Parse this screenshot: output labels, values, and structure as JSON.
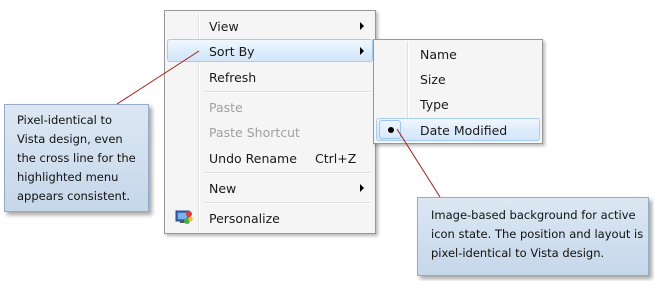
{
  "main_menu": {
    "items": [
      {
        "label": "View",
        "submenu": true
      },
      {
        "label": "Sort By",
        "submenu": true,
        "highlighted": true
      },
      {
        "label": "Refresh"
      },
      {
        "label": "Paste",
        "disabled": true
      },
      {
        "label": "Paste Shortcut",
        "disabled": true
      },
      {
        "label": "Undo Rename",
        "shortcut": "Ctrl+Z"
      },
      {
        "label": "New",
        "submenu": true
      },
      {
        "label": "Personalize",
        "icon": "personalize-icon"
      }
    ]
  },
  "sort_submenu": {
    "items": [
      {
        "label": "Name"
      },
      {
        "label": "Size"
      },
      {
        "label": "Type"
      },
      {
        "label": "Date Modified",
        "checked": true,
        "highlighted": true
      }
    ]
  },
  "callouts": {
    "left": {
      "lines": [
        "Pixel-identical to",
        "Vista design, even",
        "the cross line for the",
        "highlighted menu",
        "appears consistent."
      ]
    },
    "right": {
      "lines": [
        "Image-based background for active",
        "icon state. The position and layout is",
        "pixel-identical to Vista design."
      ]
    }
  },
  "colors": {
    "menu_background": "#f5f5f5",
    "menu_border": "#979797",
    "highlight_border": "#a8ccf1",
    "highlight_fill": "#ddecfb",
    "disabled_text": "#a0a0a0",
    "callout_fill": "#c6d7ea",
    "connector_line": "#a01c1c"
  }
}
